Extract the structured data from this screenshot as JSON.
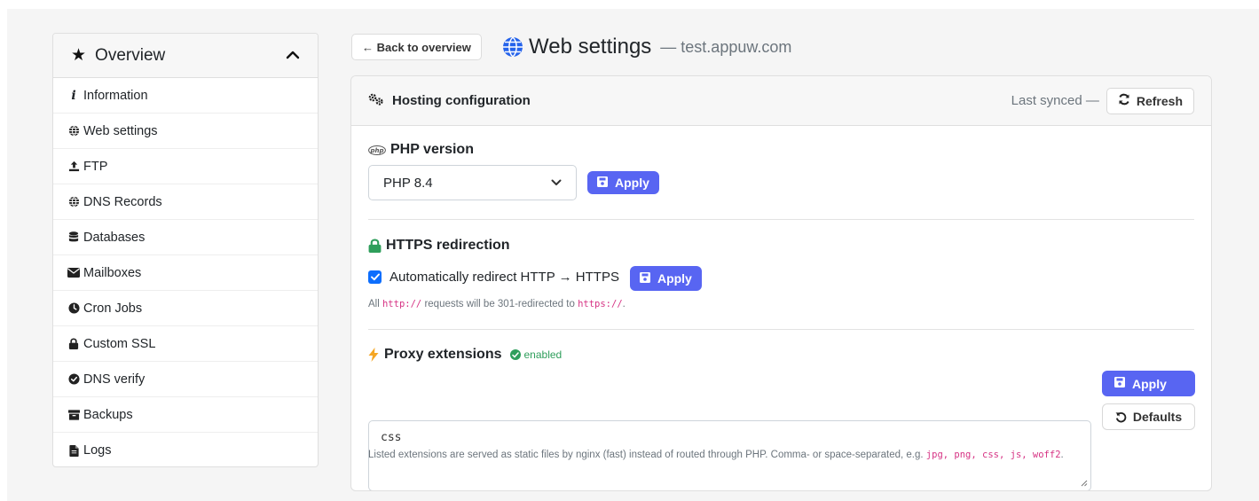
{
  "sidebar": {
    "header": "Overview",
    "items": [
      {
        "label": "Information",
        "icon": "info-icon"
      },
      {
        "label": "Web settings",
        "icon": "globe-icon"
      },
      {
        "label": "FTP",
        "icon": "upload-icon"
      },
      {
        "label": "DNS Records",
        "icon": "globe-icon"
      },
      {
        "label": "Databases",
        "icon": "database-icon"
      },
      {
        "label": "Mailboxes",
        "icon": "envelope-icon"
      },
      {
        "label": "Cron Jobs",
        "icon": "clock-icon"
      },
      {
        "label": "Custom SSL",
        "icon": "lock-icon"
      },
      {
        "label": "DNS verify",
        "icon": "check-circle-icon"
      },
      {
        "label": "Backups",
        "icon": "archive-icon"
      },
      {
        "label": "Logs",
        "icon": "file-icon"
      }
    ]
  },
  "top": {
    "back_label": "← Back to overview",
    "title": "Web settings",
    "subtitle": "— test.appuw.com"
  },
  "card": {
    "title": "Hosting configuration",
    "synced": "Last synced —",
    "refresh_label": "Refresh"
  },
  "php": {
    "title": "PHP version",
    "selected": "PHP 8.4",
    "apply_label": "Apply"
  },
  "https": {
    "title": "HTTPS redirection",
    "checkbox_label": "Automatically redirect HTTP → HTTPS",
    "checked": true,
    "apply_label": "Apply",
    "hint_pre": "All",
    "hint_code1": "http://",
    "hint_mid": "requests will be 301-redirected to",
    "hint_code2": "https://",
    "hint_post": "."
  },
  "proxy": {
    "title": "Proxy extensions",
    "badge": "enabled",
    "value": "css",
    "apply_label": "Apply",
    "defaults_label": "Defaults",
    "hint_pre": "Listed extensions are served as static files by nginx (fast) instead of routed through PHP. Comma- or space-separated, e.g.",
    "hint_code": "jpg, png, css, js, woff2",
    "hint_post": "."
  },
  "colors": {
    "accent": "#5865f2",
    "checkbox": "#0d6efd",
    "success": "#2e9e5b",
    "code": "#d63384",
    "lock": "#2e9e5b",
    "bolt": "#f5a623",
    "globe": "#2563eb"
  }
}
